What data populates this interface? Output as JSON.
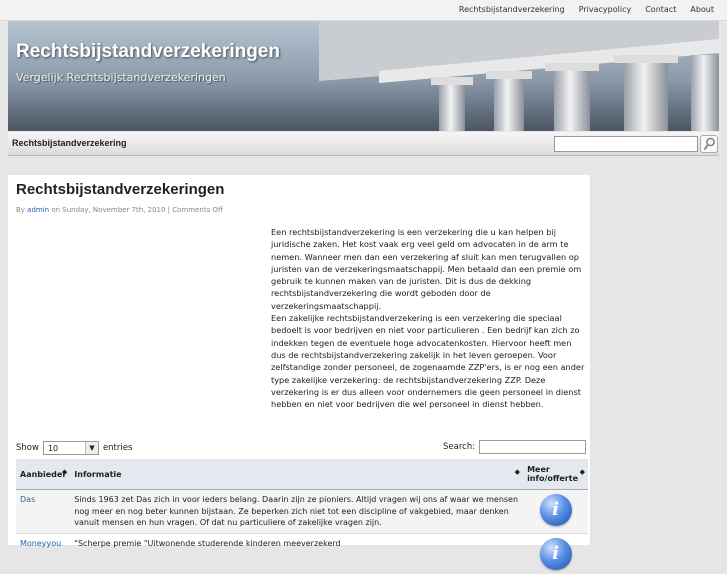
{
  "topnav": {
    "items": [
      "Rechtsbijstandverzekering",
      "Privacypolicy",
      "Contact",
      "About"
    ]
  },
  "header": {
    "title": "Rechtsbijstandverzekeringen",
    "description": "Vergelijk Rechtsbijstandverzekeringen"
  },
  "navbar": {
    "item": "Rechtsbijstandverzekering"
  },
  "post": {
    "title": "Rechtsbijstandverzekeringen",
    "meta_by": "By ",
    "meta_author": "admin",
    "meta_on": " on Sunday, November 7th, 2010 | Comments Off",
    "paragraphs": [
      "Een rechtsbijstandverzekering is een verzekering die u kan helpen bij juridische zaken. Het kost vaak erg veel geld om advocaten in de arm te nemen. Wanneer men dan een verzekering af sluit kan men terugvallen op juristen van de verzekeringsmaatschappij. Men betaald dan een premie om gebruik te kunnen maken van de juristen. Dit is dus de dekking rechtsbijstandverzekering die wordt geboden door de verzekeringsmaatschappij.",
      "Een zakelijke rechtsbijstandverzekering is een verzekering die speciaal bedoelt is voor bedrijven en niet voor particulieren . Een bedrijf kan zich zo indekken tegen de eventuele hoge advocatenkosten. Hiervoor heeft men dus de rechtsbijstandverzekering zakelijk in het leven geroepen. Voor zelfstandige zonder personeel, de zogenaamde ZZP'ers, is er nog een ander type zakelijke verzekering: de rechtsbijstandverzekering ZZP. Deze verzekering is er dus alleen voor ondernemers die geen personeel in dienst hebben en niet voor bedrijven die wel personeel in dienst hebben."
    ]
  },
  "table_controls": {
    "show_label": "Show",
    "entries_value": "10",
    "entries_label": "entries",
    "search_label": "Search:"
  },
  "table": {
    "headers": [
      "Aanbieder",
      "Informatie",
      "Meer info/offerte"
    ],
    "rows": [
      {
        "name": "Das",
        "info": "Sinds 1963 zet Das zich in voor ieders belang. Daarin zijn ze pioniers. Altijd vragen wij ons af waar we mensen nog meer en nog beter kunnen bijstaan. Ze beperken zich niet tot een discipline of vakgebied, maar denken vanuit mensen en hun vragen. Of dat nu particuliere of zakelijke vragen zijn."
      },
      {
        "name": "Moneyyou",
        "info": "\"Scherpe premie \"Uitwonende studerende kinderen meeverzekerd"
      }
    ]
  },
  "icons": {
    "search": "search-icon",
    "info": "info-icon",
    "sort": "sort-icon",
    "dropdown": "chevron-down-icon"
  },
  "colors": {
    "link": "#2266aa",
    "nav_bg": "#dcdcdc",
    "table_header": "#e3e9ef"
  }
}
